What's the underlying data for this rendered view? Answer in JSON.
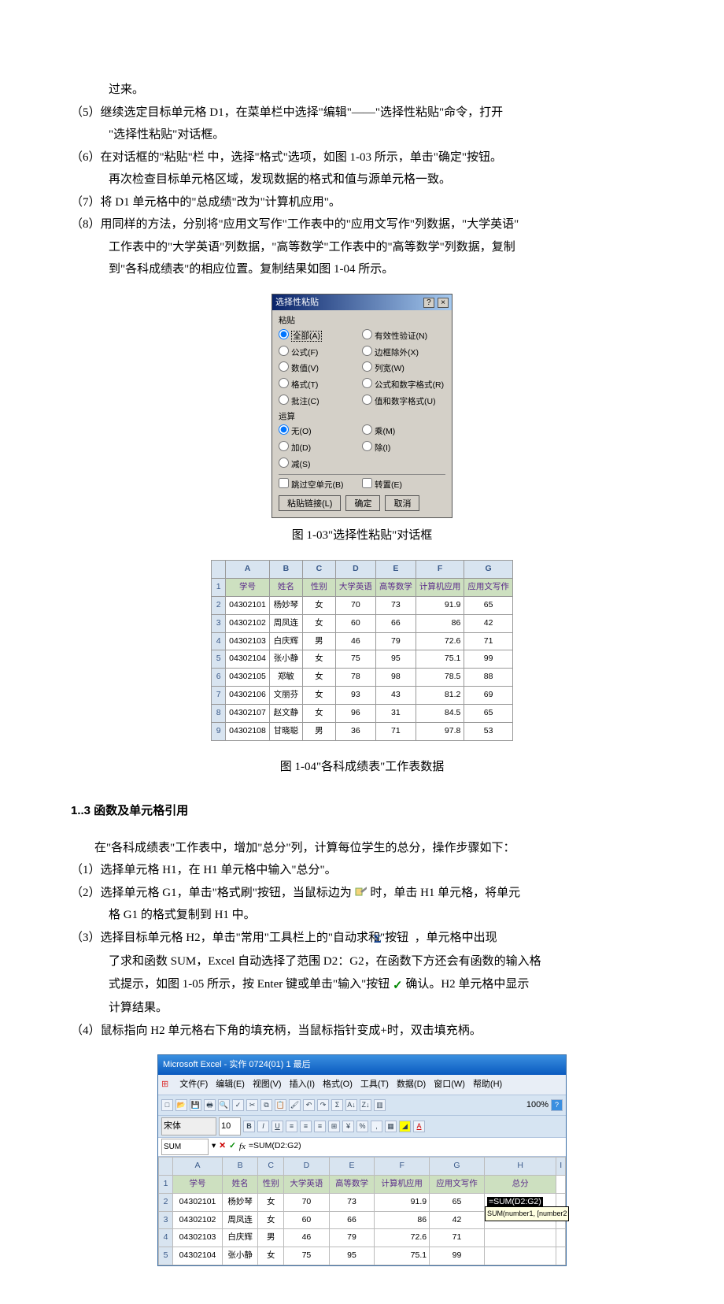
{
  "body": {
    "p0": "过来。",
    "p5a": "（5）继续选定目标单元格 D1，在菜单栏中选择\"编辑\"——\"选择性粘贴\"命令，打开",
    "p5b": "\"选择性粘贴\"对话框。",
    "p6a": "（6）在对话框的\"粘贴\"栏 中，选择\"格式\"选项，如图 1-03 所示，单击\"确定\"按钮。",
    "p6b": "再次检查目标单元格区域，发现数据的格式和值与源单元格一致。",
    "p7": "（7）将 D1 单元格中的\"总成绩\"改为\"计算机应用\"。",
    "p8a": "（8）用同样的方法，分别将\"应用文写作\"工作表中的\"应用文写作\"列数据，\"大学英语\"",
    "p8b": "工作表中的\"大学英语\"列数据，\"高等数学\"工作表中的\"高等数学\"列数据，复制",
    "p8c": "到\"各科成绩表\"的相应位置。复制结果如图 1-04 所示。",
    "fig103_caption": "图 1-03\"选择性粘贴\"对话框",
    "fig104_caption": "图 1-04\"各科成绩表\"工作表数据",
    "section_title": "1..3 函数及单元格引用",
    "s0": "在\"各科成绩表\"工作表中，增加\"总分\"列，计算每位学生的总分，操作步骤如下：",
    "s1": "（1）选择单元格 H1，在 H1 单元格中输入\"总分\"。",
    "s2a_pre": "（2）选择单元格 G1，单击\"格式刷\"按钮，当鼠标边为",
    "s2a_post": "时，单击 H1 单元格，将单元",
    "s2b": "格 G1 的格式复制到 H1 中。",
    "s3a_pre": "（3）选择目标单元格 H2，单击\"常用\"工具栏上的\"自动求和\"按钮",
    "s3a_post": "，单元格中出现",
    "s3b": "了求和函数 SUM，Excel 自动选择了范围 D2：G2，在函数下方还会有函数的输入格",
    "s3c_pre": "式提示，如图 1-05 所示，按 Enter 键或单击\"输入\"按钮",
    "s3c_post": "确认。H2 单元格中显示",
    "s3d": "计算结果。",
    "s4": "（4）鼠标指向 H2 单元格右下角的填充柄，当鼠标指针变成+时，双击填充柄。"
  },
  "dialog": {
    "title": "选择性粘贴",
    "group_paste": "粘贴",
    "opt_all": "全部(A)",
    "opt_formula": "公式(F)",
    "opt_value": "数值(V)",
    "opt_format": "格式(T)",
    "opt_comment": "批注(C)",
    "opt_valid": "有效性验证(N)",
    "opt_border": "边框除外(X)",
    "opt_colwidth": "列宽(W)",
    "opt_numfmt": "公式和数字格式(R)",
    "opt_valnumfmt": "值和数字格式(U)",
    "group_op": "运算",
    "op_none": "无(O)",
    "op_add": "加(D)",
    "op_sub": "减(S)",
    "op_mul": "乘(M)",
    "op_div": "除(I)",
    "chk_skip": "跳过空单元(B)",
    "chk_trans": "转置(E)",
    "btn_link": "粘贴链接(L)",
    "btn_ok": "确定",
    "btn_cancel": "取消"
  },
  "sheet104": {
    "cols": [
      "A",
      "B",
      "C",
      "D",
      "E",
      "F",
      "G"
    ],
    "headers": [
      "学号",
      "姓名",
      "性别",
      "大学英语",
      "高等数学",
      "计算机应用",
      "应用文写作"
    ],
    "rows": [
      [
        "04302101",
        "杨妙琴",
        "女",
        "70",
        "73",
        "91.9",
        "65"
      ],
      [
        "04302102",
        "周凤连",
        "女",
        "60",
        "66",
        "86",
        "42"
      ],
      [
        "04302103",
        "白庆辉",
        "男",
        "46",
        "79",
        "72.6",
        "71"
      ],
      [
        "04302104",
        "张小静",
        "女",
        "75",
        "95",
        "75.1",
        "99"
      ],
      [
        "04302105",
        "郑敏",
        "女",
        "78",
        "98",
        "78.5",
        "88"
      ],
      [
        "04302106",
        "文丽芬",
        "女",
        "93",
        "43",
        "81.2",
        "69"
      ],
      [
        "04302107",
        "赵文静",
        "女",
        "96",
        "31",
        "84.5",
        "65"
      ],
      [
        "04302108",
        "甘晓聪",
        "男",
        "36",
        "71",
        "97.8",
        "53"
      ]
    ]
  },
  "excel": {
    "title": "Microsoft Excel - 实作 0724(01) 1 最后",
    "menu": [
      "文件(F)",
      "编辑(E)",
      "视图(V)",
      "插入(I)",
      "格式(O)",
      "工具(T)",
      "数据(D)",
      "窗口(W)",
      "帮助(H)"
    ],
    "namebox": "SUM",
    "formula": "=SUM(D2:G2)",
    "zoom": "100%",
    "fontsize": "10",
    "cols": [
      "A",
      "B",
      "C",
      "D",
      "E",
      "F",
      "G",
      "H",
      "I"
    ],
    "headers": [
      "学号",
      "姓名",
      "性别",
      "大学英语",
      "高等数学",
      "计算机应用",
      "应用文写作",
      "总分",
      ""
    ],
    "editcell": "=SUM(D2:G2)",
    "tooltip": "SUM(number1, [number2",
    "rows": [
      [
        "04302101",
        "杨妙琴",
        "女",
        "70",
        "73",
        "91.9",
        "65"
      ],
      [
        "04302102",
        "周凤连",
        "女",
        "60",
        "66",
        "86",
        "42"
      ],
      [
        "04302103",
        "白庆辉",
        "男",
        "46",
        "79",
        "72.6",
        "71"
      ],
      [
        "04302104",
        "张小静",
        "女",
        "75",
        "95",
        "75.1",
        "99"
      ]
    ]
  }
}
